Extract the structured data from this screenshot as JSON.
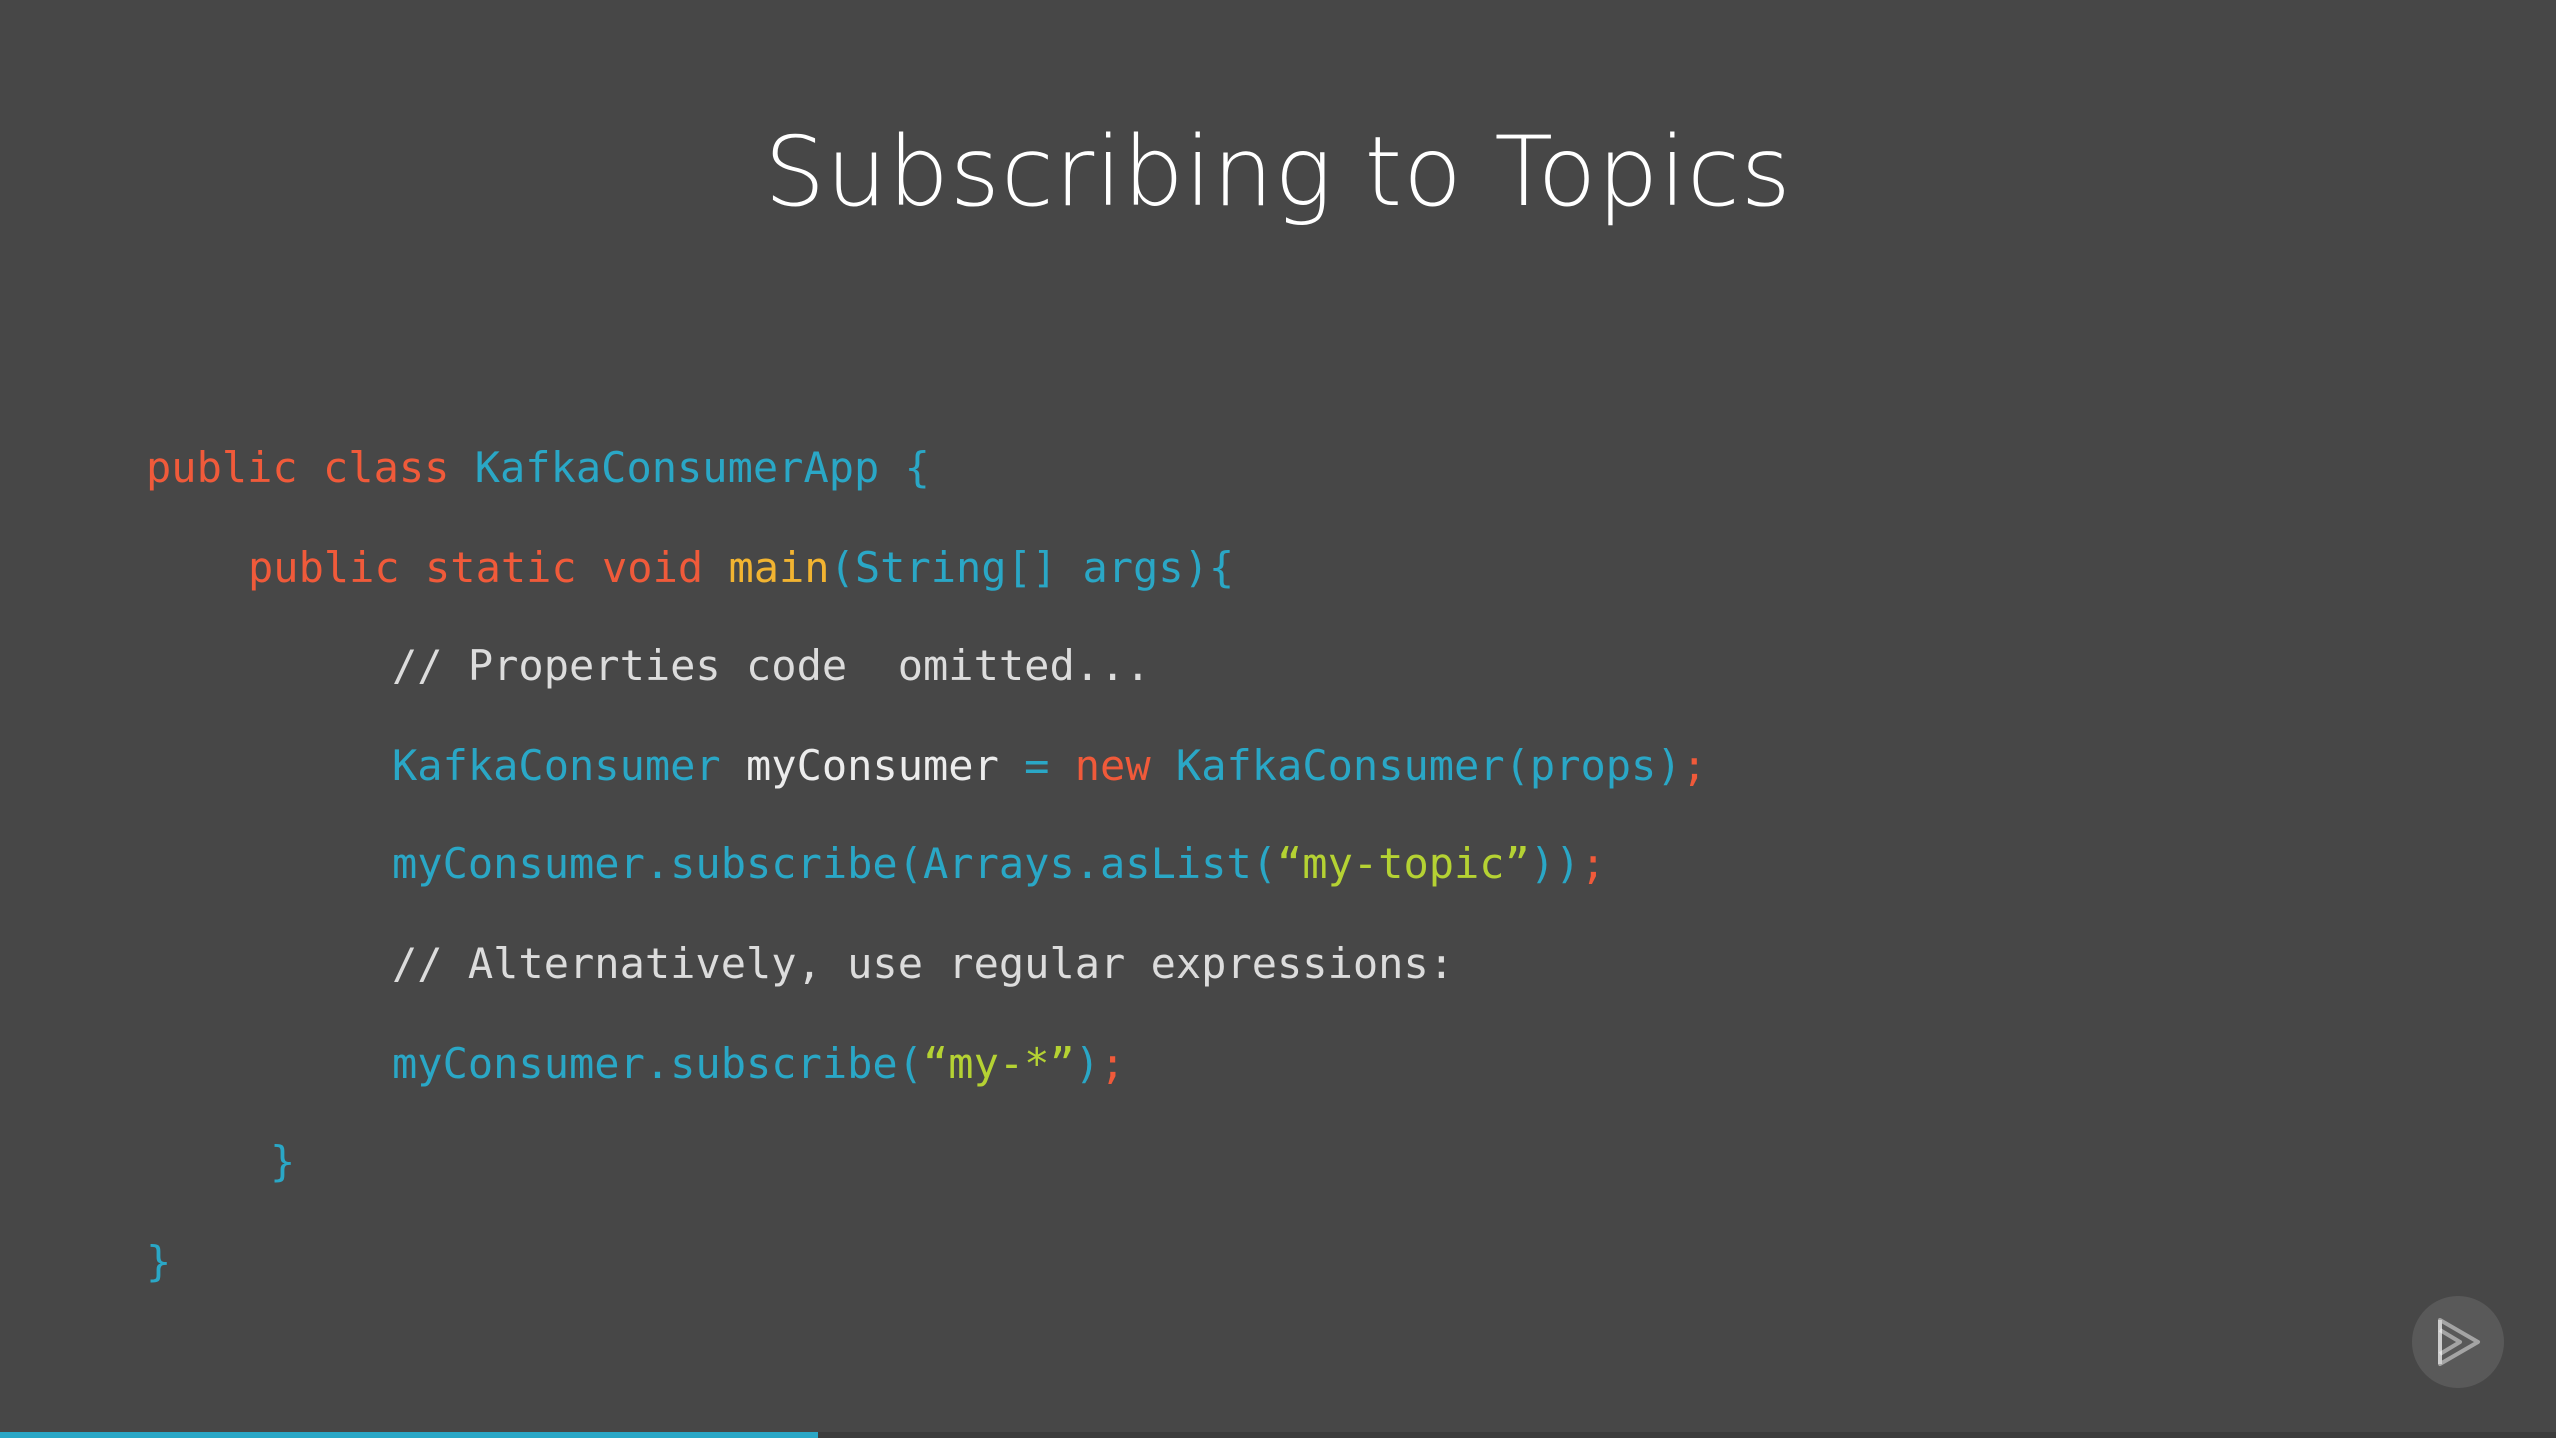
{
  "slide": {
    "title": "Subscribing to Topics"
  },
  "code": {
    "line1": {
      "t1": "public class ",
      "t2": "KafkaConsumerApp {"
    },
    "line2": {
      "t1": "public static void ",
      "t2": "main",
      "t3": "(String[] args){"
    },
    "line3": {
      "t1": "// Properties code  omitted..."
    },
    "line4": {
      "t1": "KafkaConsumer ",
      "t2": "myConsumer ",
      "t3": "= ",
      "t4": "new ",
      "t5": "KafkaConsumer(props)",
      "t6": ";"
    },
    "line5": {
      "t1": "myConsumer.subscribe(Arrays.asList(",
      "t2": "“my-topic”",
      "t3": "))",
      "t4": ";"
    },
    "line6": {
      "t1": "// Alternatively, use regular expressions:"
    },
    "line7": {
      "t1": "myConsumer.subscribe(",
      "t2": "“my-*”",
      "t3": ")",
      "t4": ";"
    },
    "line8": {
      "t1": "}"
    },
    "line9": {
      "t1": "}"
    }
  },
  "player": {
    "progress_fraction": 0.32,
    "icon": "play-logo-icon"
  },
  "colors": {
    "background": "#474747",
    "keyword": "#f05a3a",
    "type": "#2aa7c6",
    "function": "#f2b431",
    "string": "#b5d233",
    "comment": "#dcdcdc",
    "progress": "#2aa7c6"
  }
}
